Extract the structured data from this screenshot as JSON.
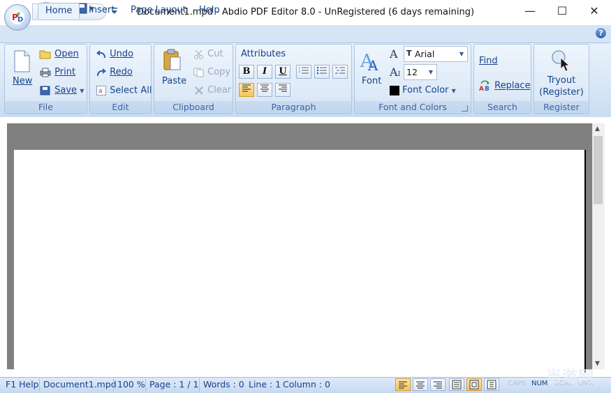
{
  "window": {
    "title": "Document1.mpd - Abdio PDF Editor 8.0 - UnRegistered (6 days remaining)",
    "minimize": "—",
    "maximize": "☐",
    "close": "✕"
  },
  "tabs": [
    {
      "label": "Home",
      "active": true
    },
    {
      "label": "Insert",
      "active": false
    },
    {
      "label": "Page Layout",
      "active": false
    },
    {
      "label": "Help",
      "active": false
    }
  ],
  "help_button": "?",
  "ribbon": {
    "file": {
      "label": "File",
      "new": "New",
      "open": "Open",
      "print": "Print",
      "save": "Save"
    },
    "edit": {
      "label": "Edit",
      "undo": "Undo",
      "redo": "Redo",
      "select_all": "Select All"
    },
    "clipboard": {
      "label": "Clipboard",
      "paste": "Paste",
      "cut": "Cut",
      "copy": "Copy",
      "clear": "Clear"
    },
    "paragraph": {
      "label": "Paragraph",
      "attributes": "Attributes",
      "bold": "B",
      "italic": "I",
      "underline": "U"
    },
    "font": {
      "label": "Font and Colors",
      "font": "Font",
      "font_name": "Arial",
      "font_size": "12",
      "font_color": "Font Color",
      "font_color_value": "#000000"
    },
    "search": {
      "label": "Search",
      "find": "Find",
      "replace": "Replace"
    },
    "register": {
      "label": "Register",
      "tryout": "Tryout",
      "tryout2": "(Register)"
    }
  },
  "status": {
    "help": "F1 Help",
    "file": "Document1.mpd",
    "zoom": "100 %",
    "page": "Page : 1 / 1",
    "words": "Words : 0",
    "line": "Line : 1",
    "column": "Column : 0",
    "caps": "CAPS",
    "num": "NUM",
    "scrl": "SCRL",
    "ovr": "OVR"
  },
  "watermark": "当游网",
  "colors": {
    "accent": "#15428b",
    "ribbon_bg": "#d5e4f5",
    "doc_bg": "#808080",
    "active_toggle": "#f9c45a"
  }
}
